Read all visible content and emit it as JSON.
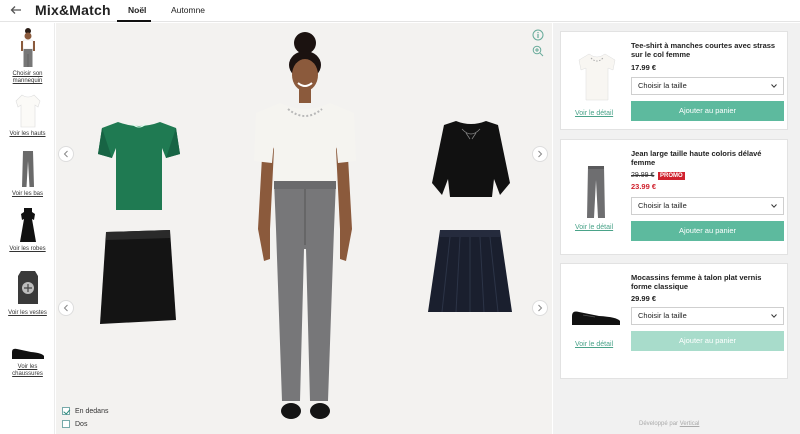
{
  "header": {
    "brand": "Mix&Match",
    "tabs": [
      {
        "label": "Noël",
        "active": true
      },
      {
        "label": "Automne",
        "active": false
      }
    ]
  },
  "sidebar": {
    "items": [
      {
        "label_line1": "Choisir son",
        "label_line2": "mannequin",
        "icon": "model-icon"
      },
      {
        "label_line1": "Voir les hauts",
        "icon": "top-icon"
      },
      {
        "label_line1": "Voir les bas",
        "icon": "jeans-icon"
      },
      {
        "label_line1": "Voir les robes",
        "icon": "dress-icon"
      },
      {
        "label_line1": "Voir les vestes",
        "icon": "jacket-icon"
      },
      {
        "label_line1": "Voir les",
        "label_line2": "chaussures",
        "icon": "shoe-icon"
      }
    ]
  },
  "stage": {
    "options": [
      {
        "label": "En dedans",
        "checked": true
      },
      {
        "label": "Dos",
        "checked": false
      }
    ]
  },
  "products": [
    {
      "title": "Tee-shirt à manches courtes avec strass sur le col femme",
      "price": "17.99 €",
      "size_select": "Choisir la taille",
      "cta": "Ajouter au panier",
      "detail": "Voir le détail"
    },
    {
      "title": "Jean large taille haute coloris délavé femme",
      "old_price": "29.99 €",
      "promo": "PROMO",
      "price": "23.99 €",
      "size_select": "Choisir la taille",
      "cta": "Ajouter au panier",
      "detail": "Voir le détail"
    },
    {
      "title": "Mocassins femme à talon plat vernis forme classique",
      "price": "29.99 €",
      "size_select": "Choisir la taille",
      "cta": "Ajouter au panier",
      "cta_disabled": true,
      "detail": "Voir le détail"
    }
  ],
  "footer": {
    "powered_prefix": "Développé par ",
    "powered_brand": "Vertical"
  },
  "colors": {
    "accent": "#5dba9e",
    "promo": "#d0222e",
    "stage_bg": "#f3f2f0"
  }
}
